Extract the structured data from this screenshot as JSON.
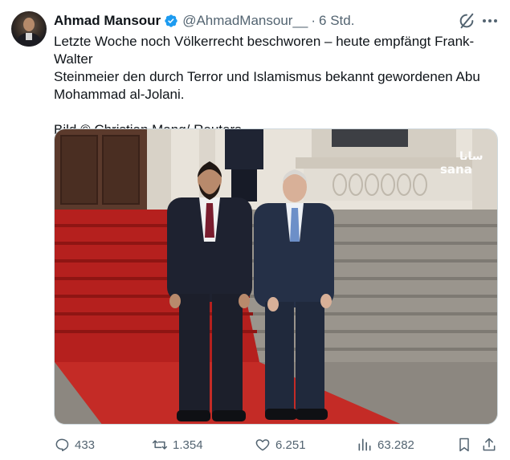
{
  "author": {
    "name": "Ahmad Mansour",
    "handle": "@AhmadMansour__",
    "separator": "·",
    "time": "6 Std."
  },
  "tweet": {
    "lines": [
      "Letzte Woche noch Völkerrecht beschworen – heute empfängt Frank-Walter",
      "Steinmeier den durch Terror und Islamismus bekannt gewordenen Abu",
      "Mohammad al-Jolani."
    ],
    "credit": "Bild © Christian Mang/ Reuters"
  },
  "media": {
    "watermark": "sana"
  },
  "actions": {
    "replies": "433",
    "reposts": "1.354",
    "likes": "6.251",
    "views": "63.282"
  },
  "icons": {
    "verified": "verified-badge-icon",
    "grok": "grok-icon",
    "more": "more-icon",
    "reply": "reply-icon",
    "repost": "repost-icon",
    "like": "heart-icon",
    "views": "views-icon",
    "bookmark": "bookmark-icon",
    "share": "share-icon"
  },
  "colors": {
    "text": "#0f1419",
    "secondary": "#536471",
    "verified": "#1d9bf0",
    "carpet": "#b5201e"
  }
}
